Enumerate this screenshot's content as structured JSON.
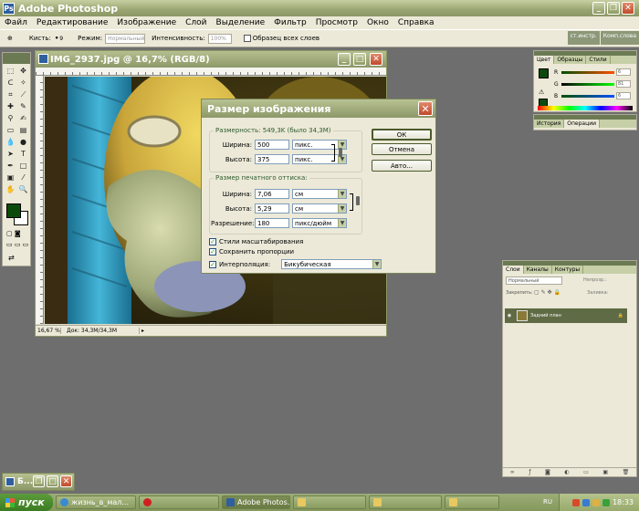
{
  "app": {
    "title": "Adobe Photoshop"
  },
  "menu": [
    "Файл",
    "Редактирование",
    "Изображение",
    "Слой",
    "Выделение",
    "Фильтр",
    "Просмотр",
    "Окно",
    "Справка"
  ],
  "options_bar": {
    "brush_label": "Кисть:",
    "brush_size": "9",
    "mode_label": "Режим:",
    "mode_value": "Нормальный",
    "intensity_label": "Интенсивность:",
    "intensity_value": "100%",
    "sample_all_label": "Образец всех слоев",
    "palette_well": [
      "ст.инстр.",
      "Комп.слова"
    ]
  },
  "document": {
    "title": "IMG_2937.jpg @ 16,7% (RGB/8)",
    "zoom": "16,67 %",
    "doc_size": "Док: 34,3M/34,3M",
    "minimized_title": "Б..."
  },
  "dialog": {
    "title": "Размер изображения",
    "pixel_dimensions": "Размерность:  549,3K (было 34,3M)",
    "width_label": "Ширина:",
    "width_value": "500",
    "width_unit": "пикс.",
    "height_label": "Высота:",
    "height_value": "375",
    "height_unit": "пикс.",
    "doc_size_legend": "Размер печатного оттиска:",
    "doc_width_label": "Ширина:",
    "doc_width_value": "7,06",
    "doc_width_unit": "см",
    "doc_height_label": "Высота:",
    "doc_height_value": "5,29",
    "doc_height_unit": "см",
    "resolution_label": "Разрешение:",
    "resolution_value": "180",
    "resolution_unit": "пикс/дюйм",
    "scale_styles_label": "Стили масштабирования",
    "constrain_label": "Сохранить пропорции",
    "resample_label": "Интерполяция:",
    "resample_value": "Бикубическая",
    "ok_label": "ОК",
    "cancel_label": "Отмена",
    "auto_label": "Авто..."
  },
  "color_palette": {
    "tabs": [
      "Цвет",
      "Образцы",
      "Стили"
    ],
    "channels": [
      {
        "label": "R",
        "value": "6"
      },
      {
        "label": "G",
        "value": "81"
      },
      {
        "label": "B",
        "value": "6"
      }
    ],
    "foreground": "#0c4a0c"
  },
  "history_palette": {
    "tabs": [
      "История",
      "Операции"
    ]
  },
  "layers_palette": {
    "tabs": [
      "Слои",
      "Каналы",
      "Контуры"
    ],
    "blend_mode": "Нормальный",
    "opacity_label": "Непрозр.:",
    "lock_label": "Закрепить:",
    "fill_label": "Заливка:",
    "layer_name": "Задний план"
  },
  "taskbar": {
    "start_label": "пуск",
    "tasks": [
      "жизнь_в_мал...",
      "",
      "Adobe Photos...",
      "",
      "",
      ""
    ],
    "lang": "RU",
    "clock": "18:33"
  },
  "colors": {
    "accent": "#8b9765",
    "close": "#c04a2a",
    "foreground_swatch": "#0c4a0c"
  }
}
